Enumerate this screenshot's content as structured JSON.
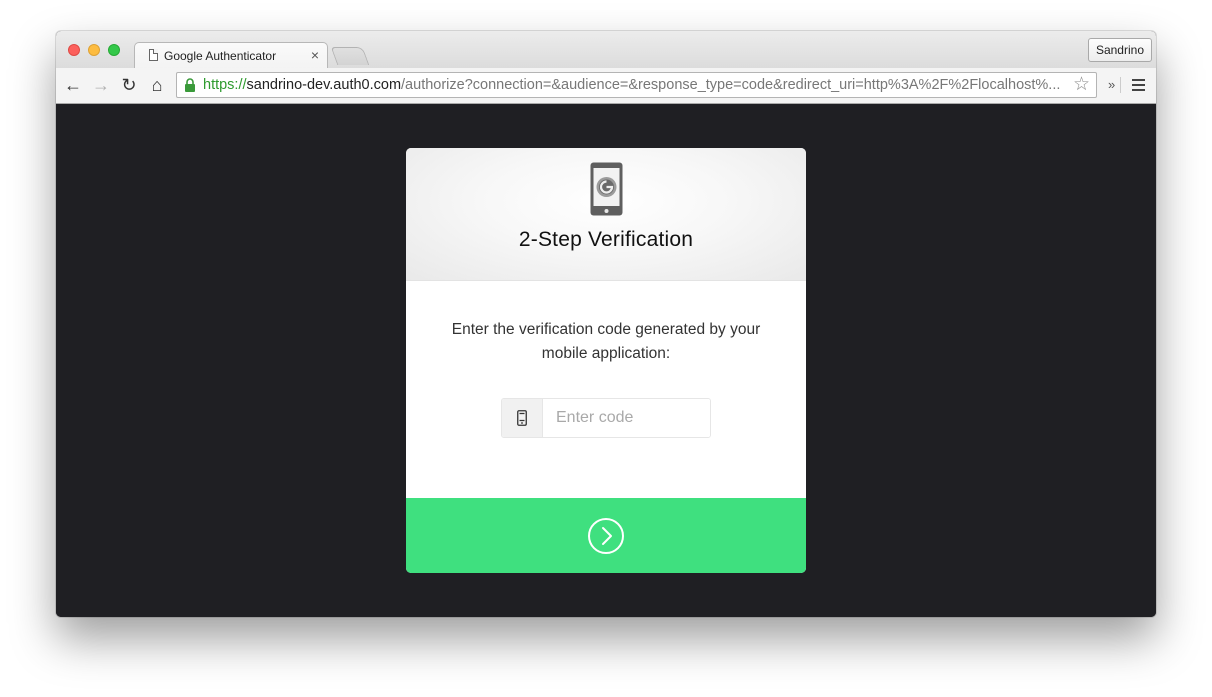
{
  "browser": {
    "tab_title": "Google Authenticator",
    "tab_close": "×",
    "profile_name": "Sandrino",
    "url_scheme": "https://",
    "url_host": "sandrino-dev.auth0.com",
    "url_rest": "/authorize?connection=&audience=&response_type=code&redirect_uri=http%3A%2F%2Flocalhost%...",
    "nav": {
      "back_glyph": "←",
      "forward_glyph": "→",
      "reload_glyph": "↻",
      "home_glyph": "⌂",
      "star_glyph": "☆",
      "extensions_glyph": "»"
    }
  },
  "auth_card": {
    "title": "2-Step Verification",
    "instructions": "Enter the verification code generated by your mobile application:",
    "code_input_placeholder": "Enter code",
    "code_input_value": "",
    "colors": {
      "submit_bar": "#3fe07f",
      "page_background": "#1f1f23"
    }
  }
}
